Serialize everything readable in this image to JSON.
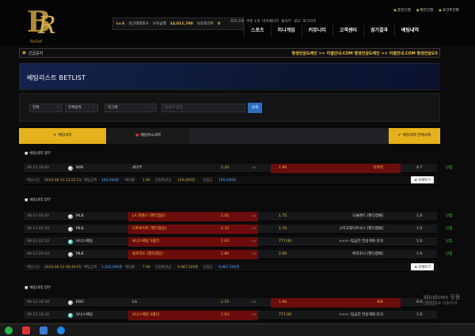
{
  "header": {
    "logo_text": "ReSell",
    "user": {
      "level": "Lv.6",
      "name": "김근태엔포사",
      "balance_label": "보유금액",
      "balance": "14,011,700",
      "points_label": "보유포인트",
      "points": "0"
    },
    "quick_links": [
      "쪽지 0개",
      "쿠폰 1개",
      "마이페이지",
      "출석부",
      "광고",
      "로그아웃"
    ],
    "top_links": [
      "충전신청",
      "환전신청",
      "포인트전환"
    ],
    "nav": [
      "스포츠",
      "미니게임",
      "커뮤니티",
      "고객센터",
      "경기결과",
      "베팅내역"
    ]
  },
  "ticker": {
    "icon": "megaphone-icon",
    "label": "긴급공지",
    "message": "평생한글도메인 >> 리셀안내.COM 평생한글도메인 >> 리셀안내.COM 평생한글도5"
  },
  "page_title": "베팅리스트 BETLIST",
  "filters": {
    "select1": "전체",
    "select2": "전체종목",
    "select3": "리그명",
    "search_placeholder": "검색어 입력",
    "search_button": "검색"
  },
  "tabs": [
    "베팅내역",
    "베팅취소내역",
    "베팅내역 전체삭제"
  ],
  "groups": [
    {
      "label": "베팅내역 정부",
      "rows": [
        {
          "date": "08-13 18:00",
          "league": "NPB",
          "home": "세이부",
          "home_odd": "2.10",
          "vs": "vs",
          "away_odd": "1.90",
          "away": "라쿠텐",
          "score": "4:7",
          "result": "당첨",
          "selected": "away"
        }
      ],
      "info": {
        "time_label": "베팅시간",
        "time": "2024-08-13 13:22:53",
        "amount_label": "베팅금액",
        "amount": "100,000원",
        "odds_label": "배당률",
        "odds": "1.90",
        "expected_label": "당첨예상금",
        "expected": "190,000원",
        "win_label": "당첨금",
        "win": "190,000원",
        "delete": "삭제하기"
      }
    },
    {
      "label": "베팅내역 정부",
      "rows": [
        {
          "date": "08-13 05:10",
          "league": "MLB",
          "home": "LA 엔젤스 [핸디캡승]",
          "home_odd": "2.05",
          "vs": "vs",
          "away_odd": "1.75",
          "away": "오클랜드 [핸디캡패]",
          "score": "1:0",
          "result": "당첨",
          "selected": "home"
        },
        {
          "date": "08-13 05:10",
          "league": "MLB",
          "home": "디트로이트 [핸디캡승]",
          "home_odd": "2.10",
          "vs": "vs",
          "away_odd": "1.70",
          "away": "시카고화이트삭스 [핸디캡패]",
          "score": "1:0",
          "result": "당첨",
          "selected": "home"
        },
        {
          "date": "08-13 05:10",
          "league": "보너스배당",
          "home": "보너스배당 3폴더",
          "home_odd": "1.03",
          "vs": "vs",
          "away_odd": "777.00",
          "away": "<<<--입금전 전용계좌 문의",
          "score": "1:0",
          "result": "당첨",
          "selected": "home"
        },
        {
          "date": "08-13 09:10",
          "league": "MLB",
          "home": "콜로라도 [핸디캡승]",
          "home_odd": "1.80",
          "vs": "vs",
          "away_odd": "2.00",
          "away": "애리조나 [핸디캡패]",
          "score": "1:0",
          "result": "당첨",
          "selected": "home"
        }
      ],
      "info": {
        "time_label": "베팅시간",
        "time": "2024-08-13 08:49:05",
        "amount_label": "베팅금액",
        "amount": "1,250,000원",
        "odds_label": "배당률",
        "odds": "7.99",
        "expected_label": "당첨예상금",
        "expected": "9,987,500원",
        "win_label": "당첨금",
        "win": "9,987,500원",
        "delete": "삭제하기"
      }
    },
    {
      "label": "베팅내역 정부",
      "rows": [
        {
          "date": "08-13 18:30",
          "league": "KBO",
          "home": "LG",
          "home_odd": "2.15",
          "vs": "vs",
          "away_odd": "1.90",
          "away": "KIA",
          "score": "8:0",
          "result": "",
          "selected": "away"
        },
        {
          "date": "08-13 18:30",
          "league": "보너스배당",
          "home": "보너스배당 3폴더",
          "home_odd": "1.03",
          "vs": "vs",
          "away_odd": "777.00",
          "away": "<<<--입금전 전용계좌 문의",
          "score": "1:0",
          "result": "",
          "selected": "home"
        }
      ]
    }
  ],
  "windows": {
    "line1": "Windows 정품",
    "line2": "[설정]으로 이동하여"
  },
  "colors": {
    "gold": "#f0c24a",
    "tab_active": "#e6b21b",
    "selected": "#6d0c0c",
    "win": "#3cc53c",
    "search_btn": "#2a6fc5"
  }
}
